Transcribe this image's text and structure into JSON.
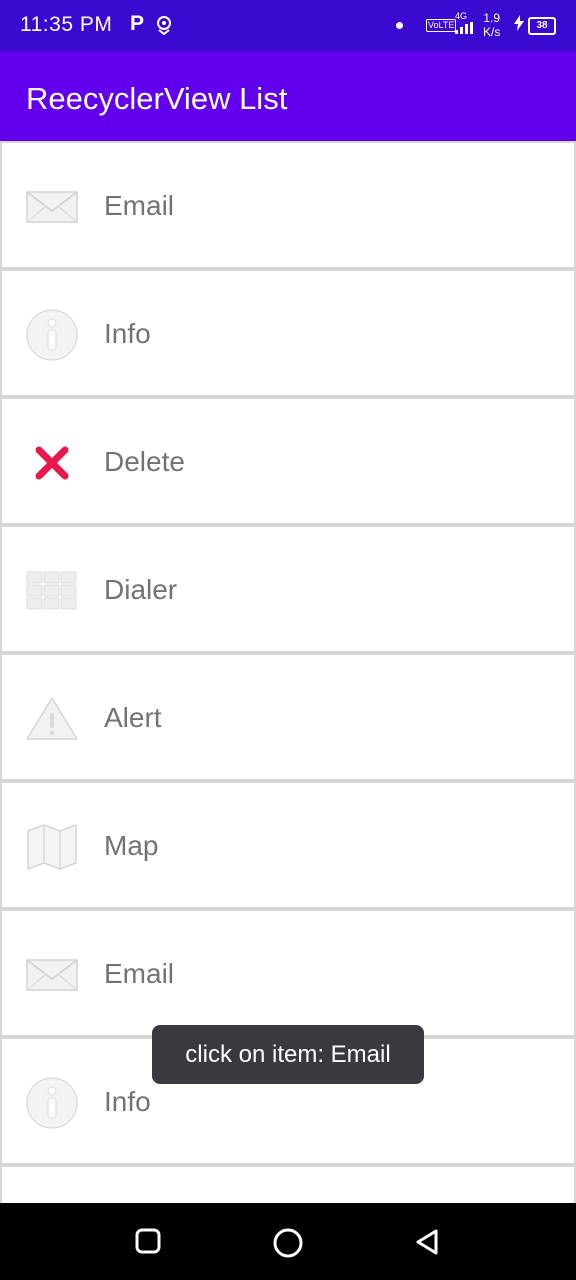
{
  "status_bar": {
    "time": "11:35 PM",
    "carrier_icon_letter": "P",
    "network_4g": "4G",
    "volte": "VoLTE",
    "speed_value": "1.9",
    "speed_unit": "K/s",
    "battery": "38"
  },
  "app_bar": {
    "title": "ReecyclerView List"
  },
  "list": {
    "items": [
      {
        "label": "Email",
        "icon": "email-icon"
      },
      {
        "label": "Info",
        "icon": "info-icon"
      },
      {
        "label": "Delete",
        "icon": "delete-icon"
      },
      {
        "label": "Dialer",
        "icon": "dialer-icon"
      },
      {
        "label": "Alert",
        "icon": "alert-icon"
      },
      {
        "label": "Map",
        "icon": "map-icon"
      },
      {
        "label": "Email",
        "icon": "email-icon"
      },
      {
        "label": "Info",
        "icon": "info-icon"
      },
      {
        "label": "",
        "icon": ""
      }
    ]
  },
  "toast": {
    "text": "click on item: Email"
  },
  "colors": {
    "status_bar": "#3a0ad0",
    "app_bar": "#6200ee",
    "delete_red": "#e8184c",
    "toast_bg": "#383a3f"
  }
}
